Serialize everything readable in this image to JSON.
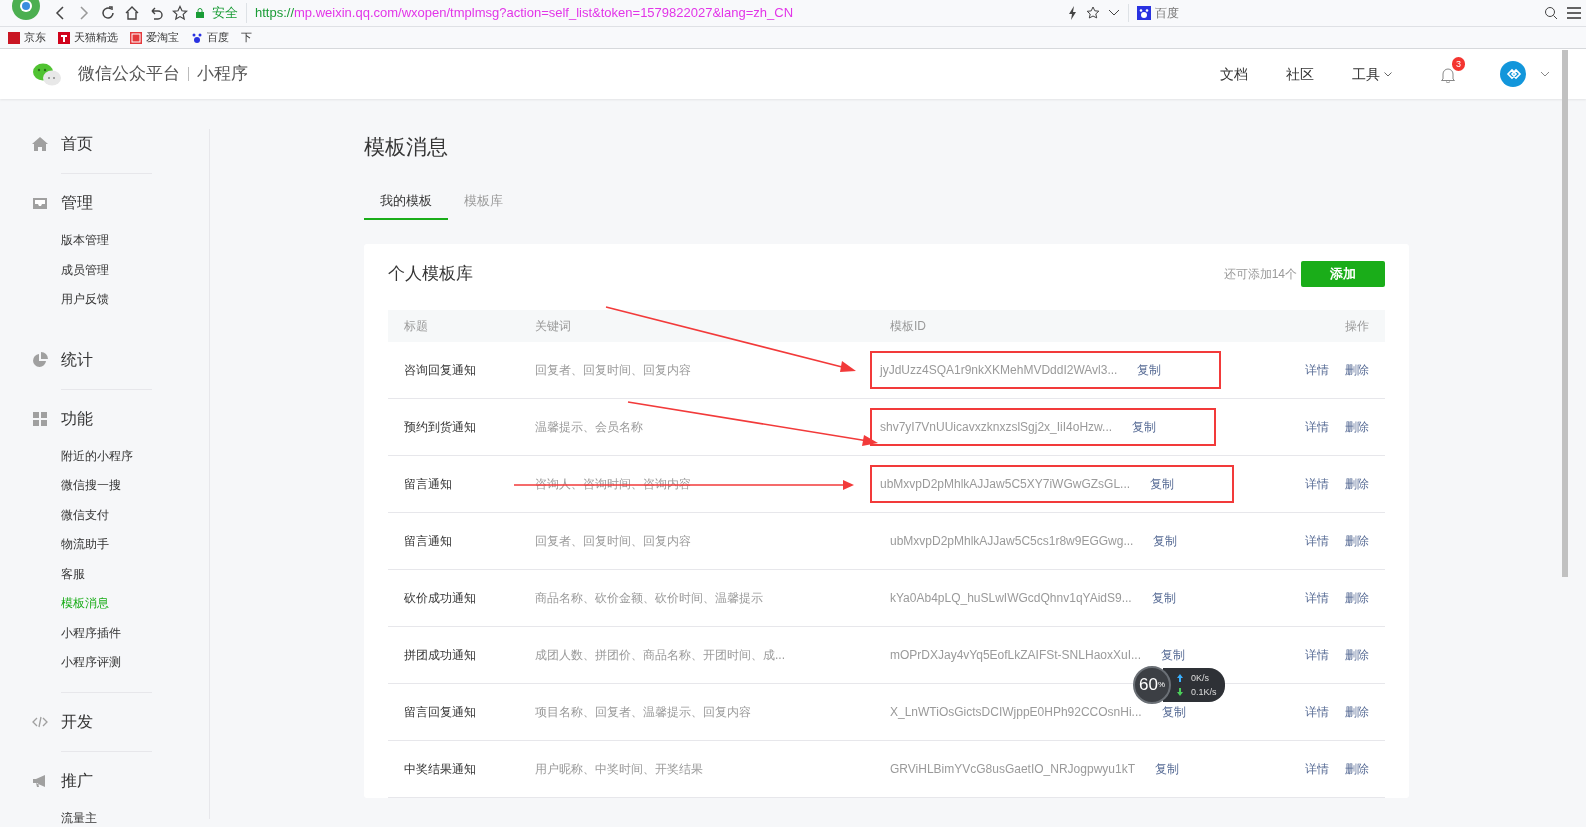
{
  "browser": {
    "url_scheme": "https://",
    "url_rest": "mp.weixin.qq.com/wxopen/tmplmsg?action=self_list&token=1579822027&lang=zh_CN",
    "secure_label": "安全",
    "search_placeholder": "百度"
  },
  "bookmarks": [
    {
      "label": "京东"
    },
    {
      "label": "天猫精选"
    },
    {
      "label": "爱淘宝"
    },
    {
      "label": "百度"
    },
    {
      "label": "下"
    }
  ],
  "header": {
    "brand": "微信公众平台",
    "product": "小程序",
    "notification_count": "3",
    "links": [
      {
        "label": "文档",
        "dropdown": false
      },
      {
        "label": "社区",
        "dropdown": false
      },
      {
        "label": "工具",
        "dropdown": true
      }
    ]
  },
  "sidebar": {
    "groups": [
      {
        "label": "首页"
      },
      {
        "label": "管理",
        "items": [
          {
            "label": "版本管理",
            "selected": false
          },
          {
            "label": "成员管理",
            "selected": false
          },
          {
            "label": "用户反馈",
            "selected": false
          }
        ]
      },
      {
        "label": "统计"
      },
      {
        "label": "功能",
        "items": [
          {
            "label": "附近的小程序",
            "selected": false
          },
          {
            "label": "微信搜一搜",
            "selected": false
          },
          {
            "label": "微信支付",
            "selected": false
          },
          {
            "label": "物流助手",
            "selected": false
          },
          {
            "label": "客服",
            "selected": false
          },
          {
            "label": "模板消息",
            "selected": true
          },
          {
            "label": "小程序插件",
            "selected": false
          },
          {
            "label": "小程序评测",
            "selected": false
          }
        ]
      },
      {
        "label": "开发"
      },
      {
        "label": "推广",
        "items": [
          {
            "label": "流量主",
            "selected": false
          }
        ]
      }
    ]
  },
  "page": {
    "title": "模板消息",
    "tabs": [
      {
        "label": "我的模板",
        "selected": true
      },
      {
        "label": "模板库",
        "selected": false
      }
    ]
  },
  "card": {
    "title": "个人模板库",
    "quota": "还可添加14个",
    "add_button": "添加"
  },
  "table": {
    "columns": [
      "标题",
      "关键词",
      "模板ID",
      "操作"
    ],
    "rows": [
      {
        "title": "咨询回复通知",
        "keywords": "回复者、回复时间、回复内容",
        "template_id": "jyJdUzz4SQA1r9nkXKMehMVDddI2WAvl3...",
        "copy": "复制",
        "actions": [
          "详情",
          "删除"
        ],
        "highlighted": true,
        "kind": "diagonal-arrow"
      },
      {
        "title": "预约到货通知",
        "keywords": "温馨提示、会员名称",
        "template_id": "shv7yI7VnUUicavxzknxzslSgj2x_IiI4oHzw...",
        "copy": "复制",
        "actions": [
          "详情",
          "删除"
        ],
        "highlighted": true,
        "kind": "diagonal-arrow"
      },
      {
        "title": "留言通知",
        "keywords": "咨询人、咨询时间、咨询内容",
        "template_id": "ubMxvpD2pMhlkAJJaw5C5XY7iWGwGZsGL...",
        "copy": "复制",
        "actions": [
          "详情",
          "删除"
        ],
        "highlighted": true,
        "kind": "horizontal-arrow"
      },
      {
        "title": "留言通知",
        "keywords": "回复者、回复时间、回复内容",
        "template_id": "ubMxvpD2pMhlkAJJaw5C5cs1r8w9EGGwg...",
        "copy": "复制",
        "actions": [
          "详情",
          "删除"
        ],
        "highlighted": false
      },
      {
        "title": "砍价成功通知",
        "keywords": "商品名称、砍价金额、砍价时间、温馨提示",
        "template_id": "kYa0Ab4pLQ_huSLwIWGcdQhnv1qYAidS9...",
        "copy": "复制",
        "actions": [
          "详情",
          "删除"
        ],
        "highlighted": false
      },
      {
        "title": "拼团成功通知",
        "keywords": "成团人数、拼团价、商品名称、开团时间、成...",
        "template_id": "mOPrDXJay4vYq5EofLkZAIFSt-SNLHaoxXuI...",
        "copy": "复制",
        "actions": [
          "详情",
          "删除"
        ],
        "highlighted": false
      },
      {
        "title": "留言回复通知",
        "keywords": "项目名称、回复者、温馨提示、回复内容",
        "template_id": "X_LnWTiOsGictsDCIWjppE0HPh92CCOsnHi...",
        "copy": "复制",
        "actions": [
          "详情",
          "删除"
        ],
        "highlighted": false
      },
      {
        "title": "中奖结果通知",
        "keywords": "用户昵称、中奖时间、开奖结果",
        "template_id": "GRViHLBimYVcG8usGaetIO_NRJogpwyu1kT",
        "copy": "复制",
        "actions": [
          "详情",
          "删除"
        ],
        "highlighted": false
      }
    ]
  },
  "speed_widget": {
    "percent": "60",
    "unit": "%",
    "upload": "0K/s",
    "download": "0.1K/s"
  }
}
